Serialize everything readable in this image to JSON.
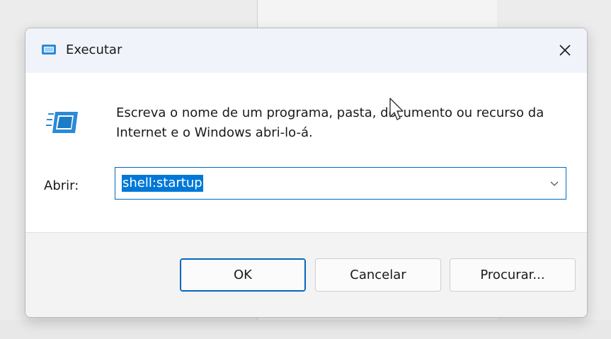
{
  "window": {
    "title": "Executar",
    "close_glyph": "✕"
  },
  "dialog": {
    "description": "Escreva o nome de um programa, pasta, documento ou recurso da Internet e o Windows abri-lo-á.",
    "open_label": "Abrir:",
    "input_value": "shell:startup",
    "input_selected": true
  },
  "buttons": {
    "ok": "OK",
    "cancel": "Cancelar",
    "browse": "Procurar..."
  },
  "icons": {
    "title": "run-icon",
    "main": "run-icon",
    "dropdown": "chevron-down-icon",
    "close": "close-icon"
  },
  "colors": {
    "accent": "#0067c0",
    "selection": "#0078d7",
    "titlebar": "#f0f3f9",
    "footer": "#f3f3f3"
  }
}
